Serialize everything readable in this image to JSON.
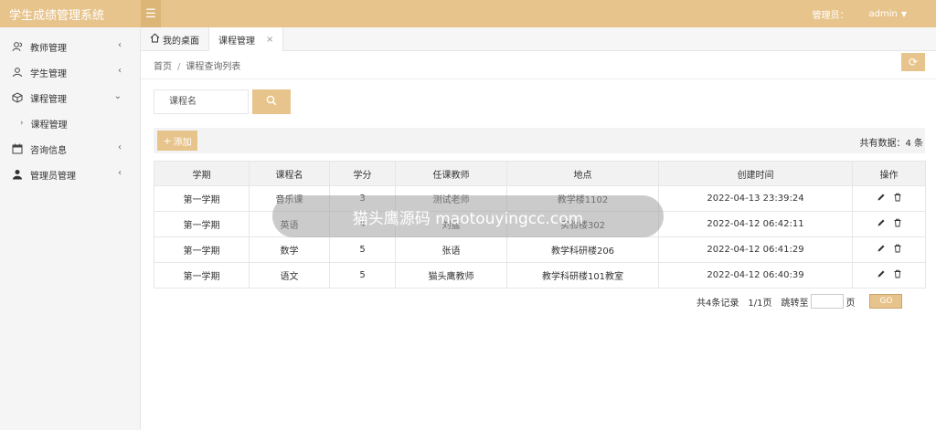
{
  "app": {
    "title": "学生成绩管理系统",
    "admin_role": "管理员：",
    "admin_name": "admin"
  },
  "sidebar": {
    "items": [
      {
        "label": "教师管理",
        "icon": "user-group-icon"
      },
      {
        "label": "学生管理",
        "icon": "user-icon"
      },
      {
        "label": "课程管理",
        "icon": "cube-icon",
        "expanded": true
      },
      {
        "label": "课程管理",
        "icon": "chevron-right-icon",
        "sub": true
      },
      {
        "label": "咨询信息",
        "icon": "calendar-icon"
      },
      {
        "label": "管理员管理",
        "icon": "admin-icon"
      }
    ]
  },
  "tabs": [
    {
      "label": "我的桌面",
      "icon": "home-icon"
    },
    {
      "label": "课程管理",
      "close": "×"
    }
  ],
  "breadcrumb": {
    "home": "首页",
    "separator": "/",
    "current": "课程查询列表"
  },
  "search": {
    "placeholder": "课程名"
  },
  "toolbar": {
    "add_label": "添加",
    "total_text": "共有数据：",
    "total_count": "4 条"
  },
  "table": {
    "headers": [
      "学期",
      "课程名",
      "学分",
      "任课教师",
      "地点",
      "创建时间",
      "操作"
    ],
    "rows": [
      [
        "第一学期",
        "音乐课",
        "3",
        "测试老师",
        "教学楼1102",
        "2022-04-13 23:39:24"
      ],
      [
        "第一学期",
        "英语",
        "4",
        "刘猛",
        "实验楼302",
        "2022-04-12 06:42:11"
      ],
      [
        "第一学期",
        "数学",
        "5",
        "张语",
        "教学科研楼206",
        "2022-04-12 06:41:29"
      ],
      [
        "第一学期",
        "语文",
        "5",
        "猫头鹰教师",
        "教学科研楼101教室",
        "2022-04-12 06:40:39"
      ]
    ]
  },
  "pager": {
    "records": "共4条记录",
    "pages": "1/1页",
    "jump_label": "跳转至",
    "page_unit": "页",
    "go_label": "GO"
  },
  "overlay": {
    "text": "猫头鹰源码 maotouyingcc.com"
  },
  "colors": {
    "accent": "#e8c48d",
    "accent_dark": "#dcb677",
    "sidebar_bg": "#f5f5f5"
  }
}
